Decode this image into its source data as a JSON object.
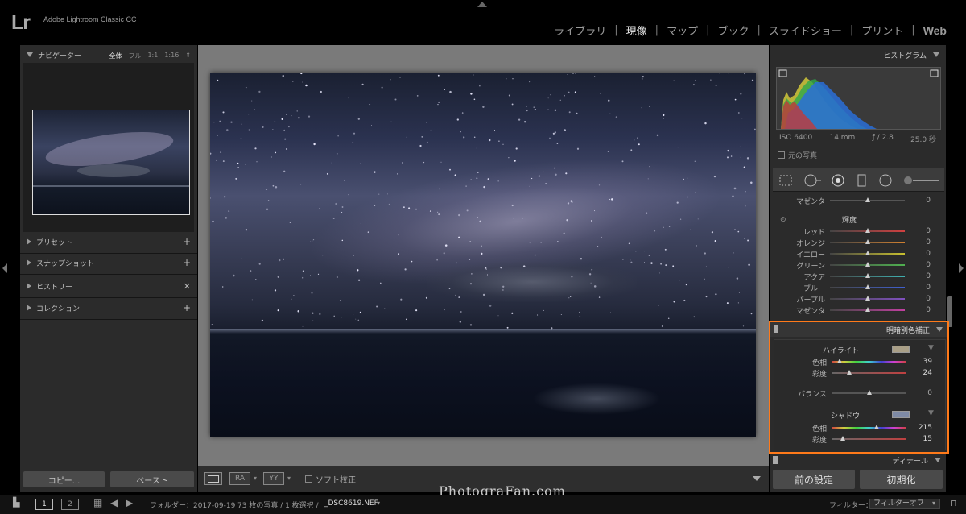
{
  "app": {
    "logo": "Lr",
    "title": "Adobe Lightroom Classic CC"
  },
  "modules": {
    "items": [
      {
        "label": "ライブラリ",
        "active": false
      },
      {
        "label": "現像",
        "active": true
      },
      {
        "label": "マップ",
        "active": false
      },
      {
        "label": "ブック",
        "active": false
      },
      {
        "label": "スライドショー",
        "active": false
      },
      {
        "label": "プリント",
        "active": false
      },
      {
        "label": "Web",
        "active": false
      }
    ],
    "separator": "|"
  },
  "left": {
    "navigator": {
      "title": "ナビゲーター",
      "zoom": {
        "fit": "全体",
        "fill": "フル",
        "one": "1:1",
        "custom": "1:16"
      }
    },
    "panels": {
      "presets": "プリセット",
      "snapshots": "スナップショット",
      "history": "ヒストリー",
      "collections": "コレクション"
    },
    "copy_label": "コピー...",
    "paste_label": "ペースト"
  },
  "toolbar": {
    "soft_proof_label": "ソフト校正",
    "before_after_1": "RA",
    "before_after_2": "YY"
  },
  "right": {
    "histogram": {
      "title": "ヒストグラム",
      "iso": "ISO 6400",
      "focal": "14 mm",
      "aperture": "ƒ / 2.8",
      "shutter": "25.0 秒",
      "original_photo": "元の写真"
    },
    "hsl": {
      "prev_row": {
        "label": "マゼンタ",
        "value": "0"
      },
      "luminance_title": "輝度",
      "rows": [
        {
          "label": "レッド",
          "value": "0",
          "color": "#d04040"
        },
        {
          "label": "オレンジ",
          "value": "0",
          "color": "#d08030"
        },
        {
          "label": "イエロー",
          "value": "0",
          "color": "#c8c030"
        },
        {
          "label": "グリーン",
          "value": "0",
          "color": "#50b050"
        },
        {
          "label": "アクア",
          "value": "0",
          "color": "#40b0b0"
        },
        {
          "label": "ブルー",
          "value": "0",
          "color": "#4060d0"
        },
        {
          "label": "パープル",
          "value": "0",
          "color": "#8050c0"
        },
        {
          "label": "マゼンタ",
          "value": "0",
          "color": "#c040a0"
        }
      ]
    },
    "split_toning": {
      "title": "明暗別色補正",
      "highlights": {
        "title": "ハイライト",
        "hue_label": "色相",
        "hue": "39",
        "hue_fraction": 0.11,
        "sat_label": "彩度",
        "sat": "24",
        "sat_fraction": 0.24,
        "swatch_color": "#a99f87"
      },
      "balance": {
        "label": "バランス",
        "value": "0",
        "fraction": 0.5
      },
      "shadows": {
        "title": "シャドウ",
        "hue_label": "色相",
        "hue": "215",
        "hue_fraction": 0.6,
        "sat_label": "彩度",
        "sat": "15",
        "sat_fraction": 0.15,
        "swatch_color": "#7e8aa5"
      }
    },
    "detail_title": "ディテール",
    "prev_settings_label": "前の設定",
    "reset_label": "初期化"
  },
  "filmstrip": {
    "view1": "1",
    "view2": "2",
    "folder_info": "フォルダー：2017-09-19",
    "count_info": "73 枚の写真 / 1 枚選択 /",
    "filename": "_DSC8619.NEF",
    "filter_label": "フィルター：",
    "filter_value": "フィルターオフ"
  },
  "watermark": "PhotograFan.com"
}
